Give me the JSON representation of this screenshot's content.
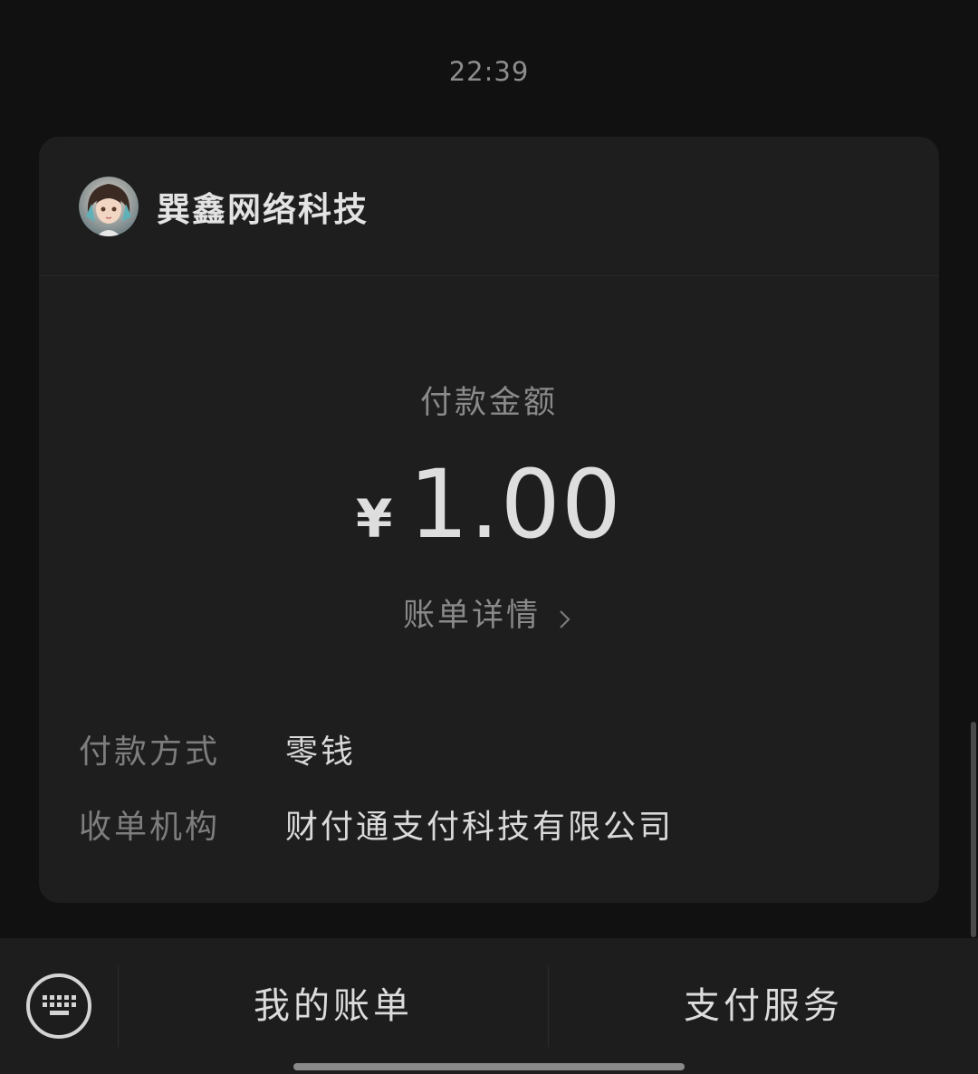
{
  "timestamp": "22:39",
  "merchant": {
    "name": "巽鑫网络科技"
  },
  "payment": {
    "amount_label": "付款金额",
    "currency_symbol": "¥",
    "amount": "1.00",
    "detail_link": "账单详情"
  },
  "info": [
    {
      "key": "付款方式",
      "value": "零钱"
    },
    {
      "key": "收单机构",
      "value": "财付通支付科技有限公司"
    }
  ],
  "bottom_bar": {
    "keyboard_icon": "keyboard-icon",
    "menu_1": "我的账单",
    "menu_2": "支付服务"
  }
}
